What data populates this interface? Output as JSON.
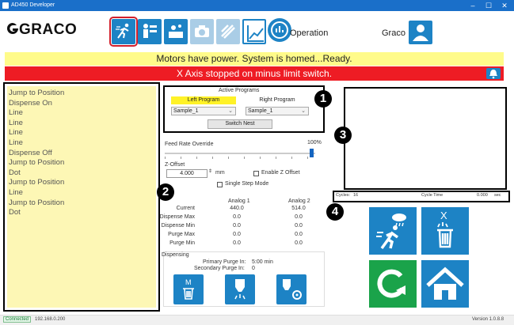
{
  "window": {
    "title": "AD450 Developer",
    "controls": [
      "–",
      "☐",
      "✕"
    ]
  },
  "toolbar": {
    "logo": "GRACO",
    "mode_label": "Operation",
    "user_label": "Graco"
  },
  "status": {
    "ready_message": "Motors have power. System is homed...Ready.",
    "alert_message": "X Axis stopped on minus limit switch."
  },
  "program_lines": [
    "Jump to Position",
    "Dispense On",
    "Line",
    "Line",
    "Line",
    "Line",
    "Dispense Off",
    "Jump to Position",
    "Dot",
    "Jump to Position",
    "Line",
    "Jump to Position",
    "Dot"
  ],
  "active_programs": {
    "title": "Active Programs",
    "left_label": "Left Program",
    "right_label": "Right Program",
    "left_value": "Sample_1",
    "right_value": "Sample_1",
    "switch_label": "Switch Nest"
  },
  "feed_rate": {
    "label": "Feed Rate Override",
    "value_text": "100%",
    "value": 1.0
  },
  "z_offset": {
    "label": "Z-Offset",
    "value": "4.000",
    "unit": "mm",
    "enable_label": "Enable Z Offset",
    "single_step_label": "Single Step Mode"
  },
  "analog": {
    "headers": [
      "Analog 1",
      "Analog 2"
    ],
    "rows": [
      {
        "label": "Current",
        "a1": "440.0",
        "a2": "514.0"
      },
      {
        "label": "Dispense Max",
        "a1": "0.0",
        "a2": "0.0"
      },
      {
        "label": "Dispense Min",
        "a1": "0.0",
        "a2": "0.0"
      },
      {
        "label": "Purge Max",
        "a1": "0.0",
        "a2": "0.0"
      },
      {
        "label": "Purge Min",
        "a1": "0.0",
        "a2": "0.0"
      }
    ]
  },
  "dispensing": {
    "title": "Dispensing",
    "primary_label": "Primary Purge In:",
    "primary_value": "5:00 min",
    "secondary_label": "Secondary Purge In:",
    "secondary_value": "0"
  },
  "cycles": {
    "cycles_label": "Cycles:",
    "cycles_value": "16",
    "cycle_time_label": "Cycle Time",
    "cycle_time_value": "0.000",
    "cycle_time_unit": "sec"
  },
  "callouts": [
    "1",
    "2",
    "3",
    "4"
  ],
  "footer": {
    "status": "Connected",
    "ip": "192.168.0.200",
    "version": "Version 1.0.8.8"
  },
  "colors": {
    "blue": "#1d83c5",
    "green": "#1aa34a",
    "yellow": "#fffb8a",
    "red": "#ee1c24",
    "program_bg": "#fdf7b5"
  }
}
